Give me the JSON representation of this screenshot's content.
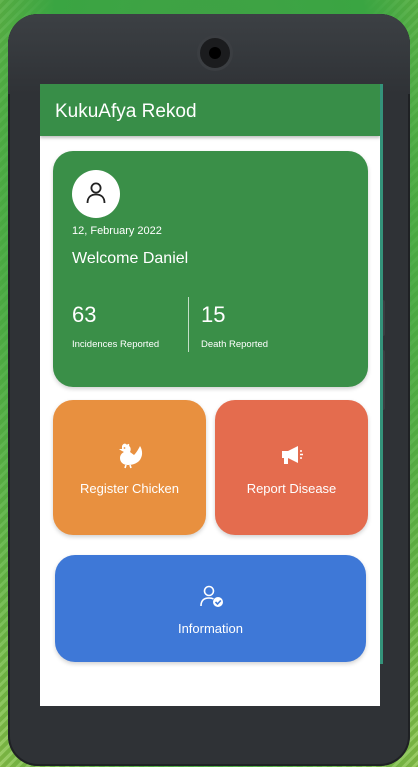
{
  "app": {
    "title": "KukuAfya Rekod"
  },
  "summary": {
    "date": "12, February 2022",
    "welcome": "Welcome Daniel",
    "incidences": {
      "count": "63",
      "label": "Incidences Reported"
    },
    "deaths": {
      "count": "15",
      "label": "Death Reported"
    }
  },
  "actions": {
    "register": {
      "label": "Register Chicken",
      "icon": "chicken-icon"
    },
    "report": {
      "label": "Report Disease",
      "icon": "megaphone-icon"
    },
    "information": {
      "label": "Information",
      "icon": "user-check-icon"
    }
  },
  "colors": {
    "appbar": "#388e48",
    "summary_card": "#3a8f48",
    "register_card": "#e8903f",
    "report_card": "#e46c4e",
    "information_card": "#3e78d7"
  }
}
